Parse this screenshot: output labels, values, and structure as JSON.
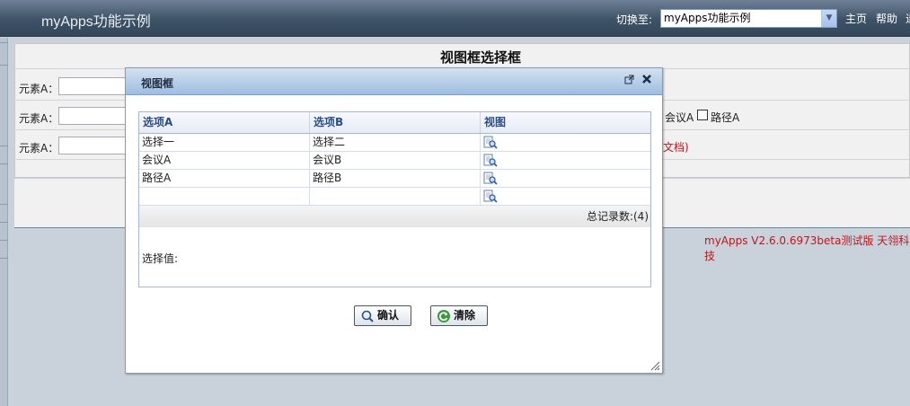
{
  "topbar": {
    "app_title": "myApps功能示例",
    "switch_label": "切换至:",
    "switch_value": "myApps功能示例",
    "links": [
      "主页",
      "帮助",
      "退"
    ]
  },
  "page": {
    "title": "视图框选择框",
    "field_label": "元素A：",
    "row2_tail": {
      "option_meeting": "会议A",
      "option_path": "路径A"
    },
    "row3_tail": "文档)",
    "footer": "myApps V2.6.0.6973beta测试版  天翎科技"
  },
  "modal": {
    "title": "视图框",
    "columns": [
      "选项A",
      "选项B",
      "视图"
    ],
    "rows": [
      {
        "a": "选择一",
        "b": "选择二"
      },
      {
        "a": "会议A",
        "b": "会议B"
      },
      {
        "a": "路径A",
        "b": "路径B"
      },
      {
        "a": "",
        "b": ""
      }
    ],
    "total": "总记录数:(4)",
    "selected_label": "选择值:",
    "confirm": "确认",
    "clear": "清除"
  },
  "icons": [
    "popout-icon",
    "close-icon",
    "view-magnifier-icon",
    "search-icon",
    "refresh-icon",
    "resize-grip-icon",
    "chevron-down-icon"
  ]
}
